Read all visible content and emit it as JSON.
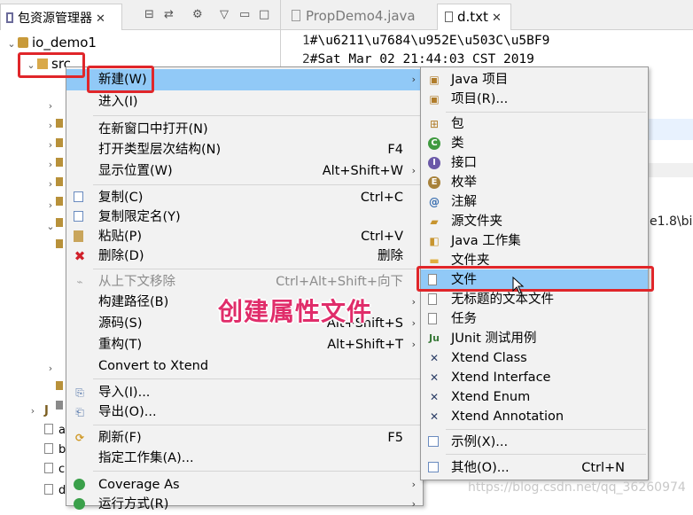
{
  "explorer": {
    "tab_title": "包资源管理器",
    "tab_close": "✕",
    "project": "io_demo1",
    "src_folder": "src",
    "bottom_rows": [
      "J",
      "a",
      "b",
      "c",
      "d"
    ]
  },
  "editor": {
    "tabs": [
      {
        "label": "PropDemo4.java"
      },
      {
        "label": "d.txt",
        "close": "✕"
      }
    ],
    "lines": [
      {
        "num": "1",
        "text": "#\\u6211\\u7684\\u952E\\u503C\\u5BF9"
      },
      {
        "num": "2",
        "text": "#Sat Mar 02 21:44:03 CST 2019"
      }
    ],
    "console_fragment": "e1.8\\bi"
  },
  "context_menu": {
    "items": [
      {
        "label": "新建(W)",
        "arrow": "›"
      },
      {
        "label": "进入(I)"
      },
      {
        "label": "在新窗口中打开(N)"
      },
      {
        "label": "打开类型层次结构(N)",
        "shortcut": "F4"
      },
      {
        "label": "显示位置(W)",
        "shortcut": "Alt+Shift+W",
        "arrow": "›"
      },
      {
        "label": "复制(C)",
        "shortcut": "Ctrl+C"
      },
      {
        "label": "复制限定名(Y)"
      },
      {
        "label": "粘贴(P)",
        "shortcut": "Ctrl+V"
      },
      {
        "label": "删除(D)",
        "shortcut": "删除"
      },
      {
        "label": "从上下文移除",
        "shortcut": "Ctrl+Alt+Shift+向下"
      },
      {
        "label": "构建路径(B)",
        "arrow": "›"
      },
      {
        "label": "源码(S)",
        "shortcut": "Alt+Shift+S",
        "arrow": "›"
      },
      {
        "label": "重构(T)",
        "shortcut": "Alt+Shift+T",
        "arrow": "›"
      },
      {
        "label": "Convert to Xtend"
      },
      {
        "label": "导入(I)..."
      },
      {
        "label": "导出(O)..."
      },
      {
        "label": "刷新(F)",
        "shortcut": "F5"
      },
      {
        "label": "指定工作集(A)..."
      },
      {
        "label": "Coverage As",
        "arrow": "›"
      },
      {
        "label": "运行方式(R)",
        "arrow": "›"
      }
    ]
  },
  "submenu": {
    "items": [
      {
        "label": "Java 项目"
      },
      {
        "label": "项目(R)..."
      },
      {
        "label": "包"
      },
      {
        "label": "类"
      },
      {
        "label": "接口"
      },
      {
        "label": "枚举"
      },
      {
        "label": "注解"
      },
      {
        "label": "源文件夹"
      },
      {
        "label": "Java 工作集"
      },
      {
        "label": "文件夹"
      },
      {
        "label": "文件"
      },
      {
        "label": "无标题的文本文件"
      },
      {
        "label": "任务"
      },
      {
        "label": "JUnit 测试用例"
      },
      {
        "label": "Xtend Class"
      },
      {
        "label": "Xtend Interface"
      },
      {
        "label": "Xtend Enum"
      },
      {
        "label": "Xtend Annotation"
      },
      {
        "label": "示例(X)..."
      },
      {
        "label": "其他(O)...",
        "shortcut": "Ctrl+N"
      }
    ]
  },
  "annotation": {
    "text": "创建属性文件"
  },
  "watermark": "https://blog.csdn.net/qq_36260974",
  "colors": {
    "selection": "#91c9f7",
    "highlight_box": "#e0262a",
    "annotation_text": "#e02d6a",
    "menu_bg": "#f2f2f2"
  }
}
